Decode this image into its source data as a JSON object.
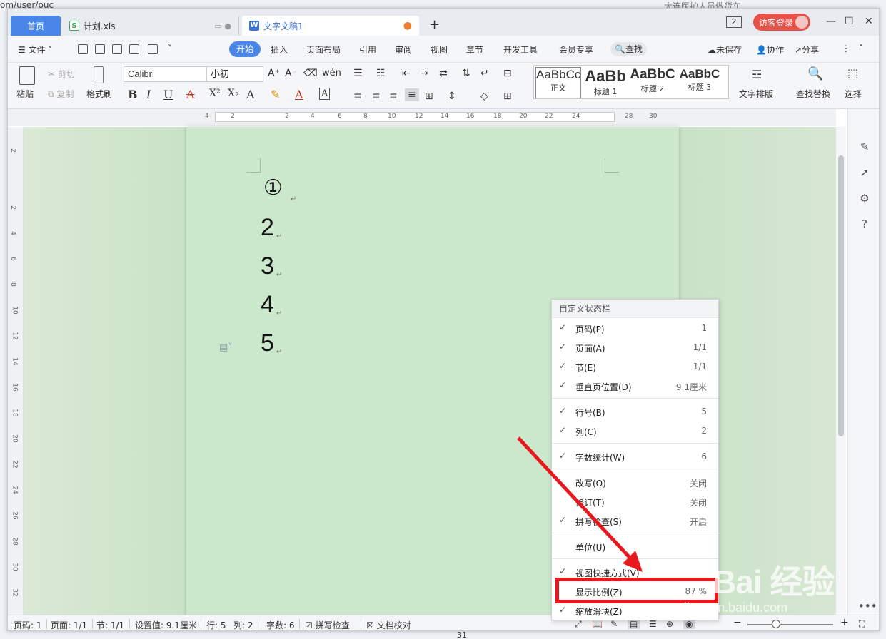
{
  "background": {
    "url_fragment": "om/user/puc",
    "right_title": "大连医护人员做货车"
  },
  "titlebar": {
    "tabs": [
      {
        "label": "首页"
      },
      {
        "label": "计划.xls",
        "icon": "S"
      },
      {
        "label": "文字文稿1",
        "icon": "W"
      }
    ],
    "new_tab": "+",
    "window_count": "2",
    "login": "访客登录",
    "controls": [
      "—",
      "☐",
      "✕"
    ]
  },
  "menubar": {
    "file": "文件",
    "items": [
      "开始",
      "插入",
      "页面布局",
      "引用",
      "审阅",
      "视图",
      "章节",
      "开发工具",
      "会员专享"
    ],
    "search": "查找",
    "right": [
      "未保存",
      "协作",
      "分享"
    ]
  },
  "ribbon": {
    "paste": "粘贴",
    "cut": "剪切",
    "copy": "复制",
    "format_painter": "格式刷",
    "font_name": "Calibri",
    "font_size": "小初",
    "styles": [
      {
        "sample": "AaBbCcI",
        "name": "正文"
      },
      {
        "sample": "AaBb",
        "name": "标题 1"
      },
      {
        "sample": "AaBbC",
        "name": "标题 2"
      },
      {
        "sample": "AaBbC",
        "name": "标题 3"
      }
    ],
    "text_layout": "文字排版",
    "find_replace": "查找替换",
    "select": "选择"
  },
  "ruler": {
    "numbers": [
      "4",
      "2",
      "2",
      "4",
      "6",
      "8",
      "10",
      "12",
      "14",
      "16",
      "18",
      "20",
      "22",
      "24",
      "28",
      "30"
    ],
    "vnumbers": [
      "2",
      "2",
      "4",
      "6",
      "8",
      "10",
      "12",
      "14",
      "16",
      "18",
      "20",
      "22",
      "24",
      "26",
      "28",
      "30",
      "32"
    ]
  },
  "document": {
    "lines": [
      "①",
      "2",
      "3",
      "4",
      "5"
    ],
    "para_mark": "↵"
  },
  "context_menu": {
    "title": "自定义状态栏",
    "items": [
      {
        "label": "页码(P)",
        "value": "1",
        "checked": true
      },
      {
        "label": "页面(A)",
        "value": "1/1",
        "checked": true
      },
      {
        "label": "节(E)",
        "value": "1/1",
        "checked": true
      },
      {
        "label": "垂直页位置(D)",
        "value": "9.1厘米",
        "checked": true
      },
      {
        "label": "行号(B)",
        "value": "5",
        "checked": true
      },
      {
        "label": "列(C)",
        "value": "2",
        "checked": true
      },
      {
        "label": "字数统计(W)",
        "value": "6",
        "checked": true
      },
      {
        "label": "改写(O)",
        "value": "关闭",
        "checked": false
      },
      {
        "label": "修订(T)",
        "value": "关闭",
        "checked": false
      },
      {
        "label": "拼写检查(S)",
        "value": "开启",
        "checked": true
      },
      {
        "label": "单位(U)",
        "value": "",
        "checked": false
      },
      {
        "label": "视图快捷方式(V)",
        "value": "",
        "checked": true
      },
      {
        "label": "显示比例(Z)",
        "value": "87 %",
        "checked": false
      },
      {
        "label": "缩放滑块(Z)",
        "value": "",
        "checked": true
      }
    ]
  },
  "statusbar": {
    "page": "页码: 1",
    "pages": "页面: 1/1",
    "section": "节: 1/1",
    "position": "设置值: 9.1厘米",
    "row": "行: 5",
    "col": "列: 2",
    "words": "字数: 6",
    "spell": "拼写检查",
    "proof": "文档校对",
    "zoom_minus": "−",
    "zoom_plus": "+"
  },
  "watermark": {
    "text": "Bai 经验",
    "sub": "jingyan.baidu.com"
  },
  "page_number_below": "31",
  "colors": {
    "accent": "#4a86e8",
    "page_green": "#cce8cc",
    "highlight_red": "#e8191e",
    "login_red": "#e8514a"
  }
}
